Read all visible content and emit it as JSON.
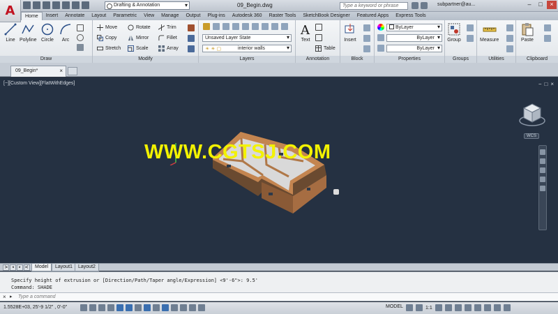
{
  "app": {
    "logo": "A",
    "document_title": "09_Begin.dwg",
    "workspace": "Drafting & Annotation",
    "search_placeholder": "Type a keyword or phrase",
    "user": "subpartner@au..."
  },
  "ribbon_tabs": [
    "Home",
    "Insert",
    "Annotate",
    "Layout",
    "Parametric",
    "View",
    "Manage",
    "Output",
    "Plug-ins",
    "Autodesk 360",
    "Raster Tools",
    "SketchBook Designer",
    "Featured Apps",
    "Express Tools"
  ],
  "panels": {
    "draw": {
      "title": "Draw",
      "tools": [
        "Line",
        "Polyline",
        "Circle",
        "Arc"
      ]
    },
    "modify": {
      "title": "Modify",
      "col1": [
        "Move",
        "Copy",
        "Stretch"
      ],
      "col2": [
        "Rotate",
        "Mirror",
        "Scale"
      ],
      "col3": [
        "Trim",
        "Fillet",
        "Array"
      ]
    },
    "layers": {
      "title": "Layers",
      "layer_state": "Unsaved Layer State",
      "current_layer": "interior walls"
    },
    "annotation": {
      "title": "Annotation",
      "text": "Text",
      "table": "Table"
    },
    "block": {
      "title": "Block",
      "insert": "Insert"
    },
    "properties": {
      "title": "Properties",
      "color": "ByLayer",
      "linetype": "ByLayer",
      "lineweight": "ByLayer"
    },
    "groups": {
      "title": "Groups",
      "group": "Group"
    },
    "utilities": {
      "title": "Utilities",
      "measure": "Measure"
    },
    "clipboard": {
      "title": "Clipboard",
      "paste": "Paste"
    }
  },
  "doc_tab": "09_Begin*",
  "viewport": {
    "label": "[−][Custom View][FlatWithEdges]",
    "wcs": "WCS",
    "watermark": "WWW.CGTSJ.COM",
    "controls": [
      "−",
      "□",
      "×"
    ]
  },
  "layout_tabs": [
    "Model",
    "Layout1",
    "Layout2"
  ],
  "command": {
    "history": [
      "Specify height of extrusion or [Direction/Path/Taper angle/Expression] <9'-6\">: 9.5'",
      "Command: SHADE"
    ],
    "placeholder": "Type a command"
  },
  "status": {
    "coordinates": "1.5528E+03,  25'-9 1/2\" , 0'-0\"",
    "model": "MODEL",
    "scale": "1:1"
  },
  "colors": {
    "viewport_bg": "#253142",
    "watermark": "#f3f200",
    "wall_exterior": "#b07848",
    "floor": "#d8d8d8"
  }
}
